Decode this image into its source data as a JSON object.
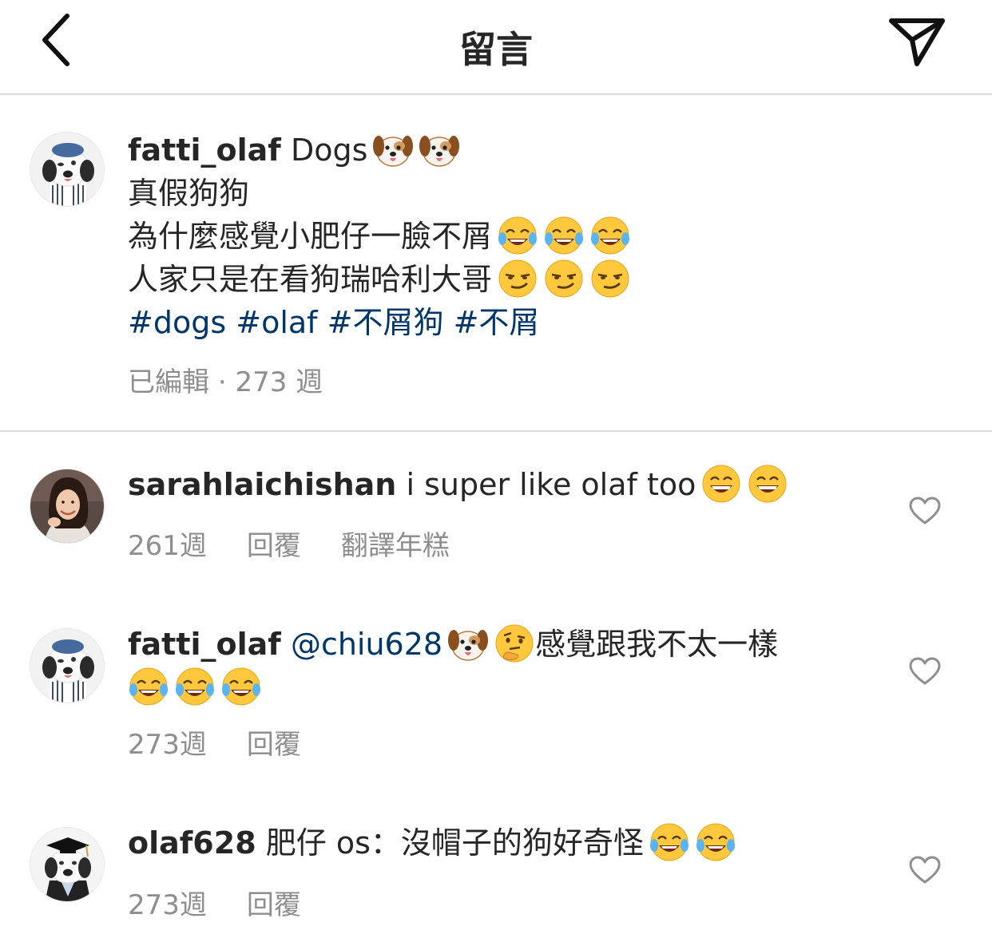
{
  "header": {
    "title": "留言",
    "back_icon": "chevron-left-icon",
    "share_icon": "paper-plane-icon"
  },
  "caption": {
    "username": "fatti_olaf",
    "line1_text": "Dogs",
    "line2": "真假狗狗",
    "line3": "為什麼感覺小肥仔一臉不屑",
    "line4": "人家只是在看狗瑞哈利大哥",
    "hashtags": [
      "#dogs",
      "#olaf",
      "#不屑狗",
      "#不屑"
    ],
    "edited_label": "已編輯",
    "time": "273 週"
  },
  "comments": [
    {
      "username": "sarahlaichishan",
      "text": "i super like olaf too",
      "time": "261週",
      "reply_label": "回覆",
      "translate_label": "翻譯年糕"
    },
    {
      "username": "fatti_olaf",
      "mention": "@chiu628",
      "text": "感覺跟我不太一樣",
      "time": "273週",
      "reply_label": "回覆"
    },
    {
      "username": "olaf628",
      "text": "肥仔 os：沒帽子的狗好奇怪",
      "time": "273週",
      "reply_label": "回覆"
    }
  ],
  "colors": {
    "text": "#262626",
    "secondary": "#8e8e8e",
    "hashtag": "#00376b",
    "divider": "#dbdbdb"
  }
}
